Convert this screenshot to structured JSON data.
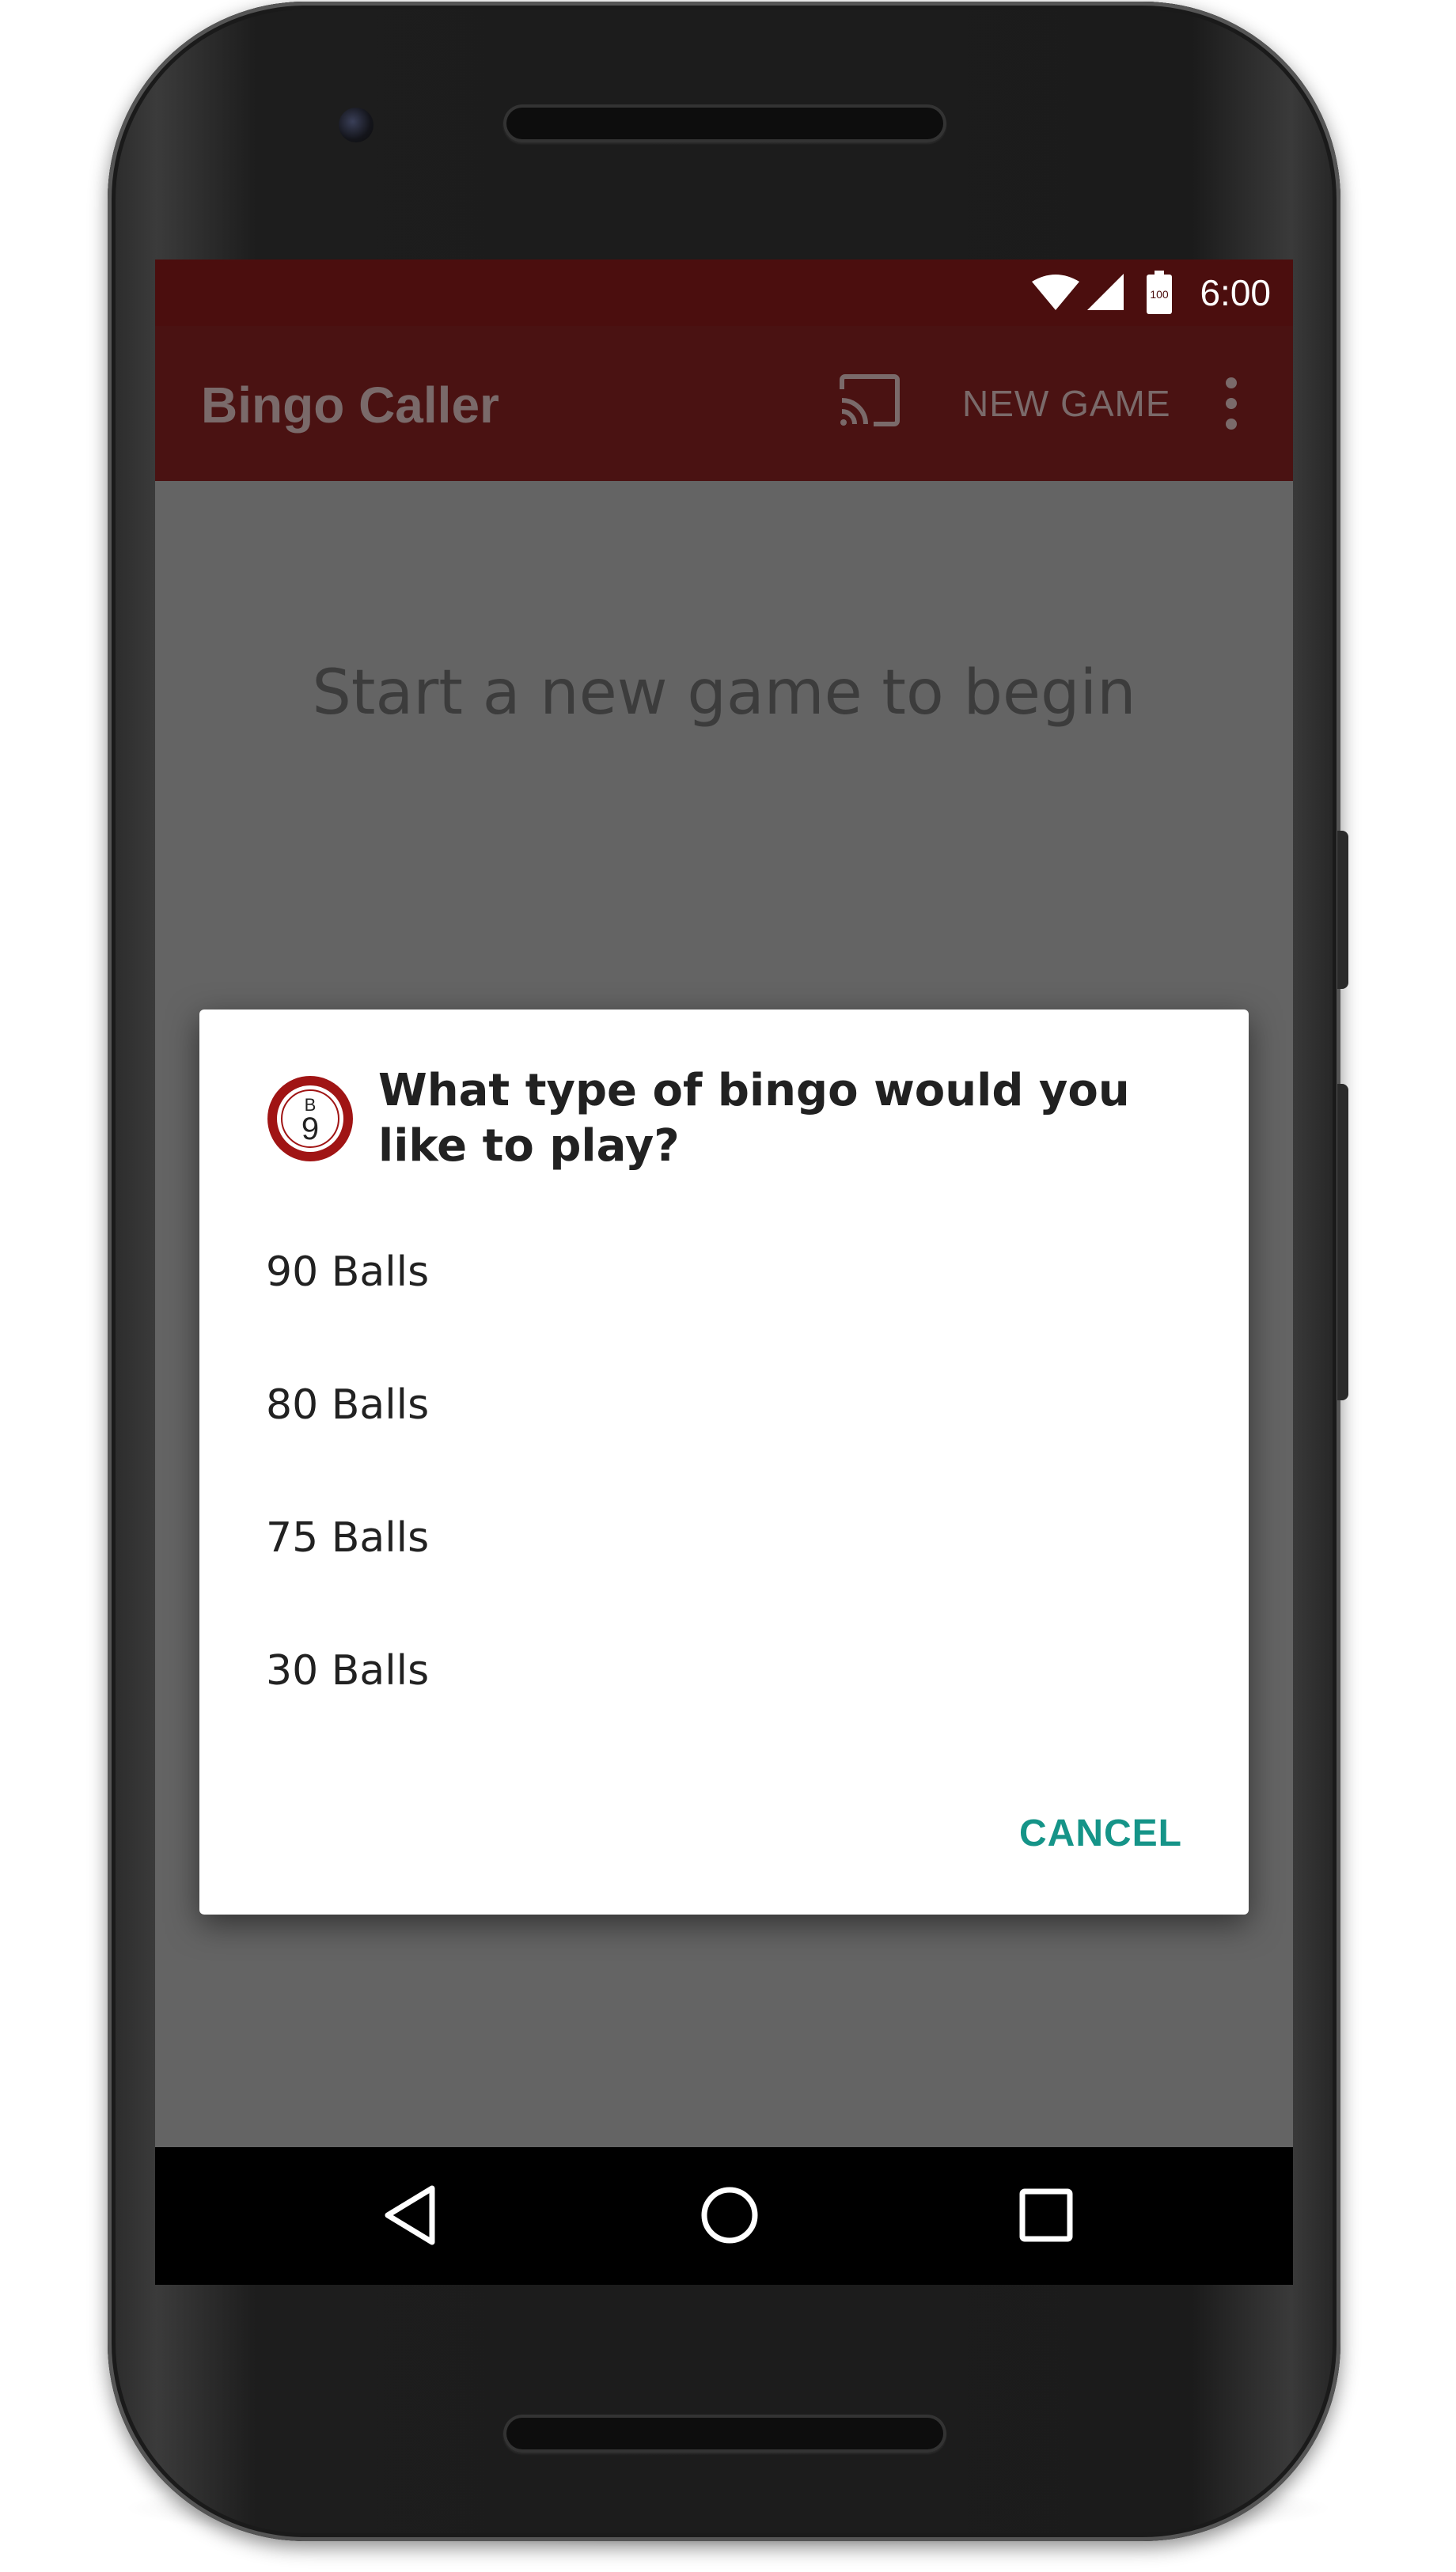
{
  "status_bar": {
    "time": "6:00",
    "battery_level": "100",
    "icons": [
      "wifi-icon",
      "signal-icon",
      "battery-icon"
    ]
  },
  "app_bar": {
    "title": "Bingo Caller",
    "actions": {
      "cast_icon": "cast-icon",
      "new_game_label": "NEW GAME",
      "overflow_icon": "overflow-menu-icon"
    }
  },
  "main": {
    "empty_message": "Start a new game to begin"
  },
  "dialog": {
    "icon": "bingo-ball-icon",
    "icon_letter": "B",
    "icon_number": "9",
    "title": "What type of bingo would you like to play?",
    "options": [
      {
        "label": "90 Balls"
      },
      {
        "label": "80 Balls"
      },
      {
        "label": "75 Balls"
      },
      {
        "label": "30 Balls"
      }
    ],
    "cancel_label": "CANCEL"
  },
  "nav_bar": {
    "icons": [
      "back-icon",
      "home-icon",
      "recents-icon"
    ]
  },
  "colors": {
    "status_bar": "#4b0e0e",
    "app_bar": "#4a1212",
    "scrim_background": "#646464",
    "accent": "#159488",
    "ball_red": "#a01414"
  }
}
